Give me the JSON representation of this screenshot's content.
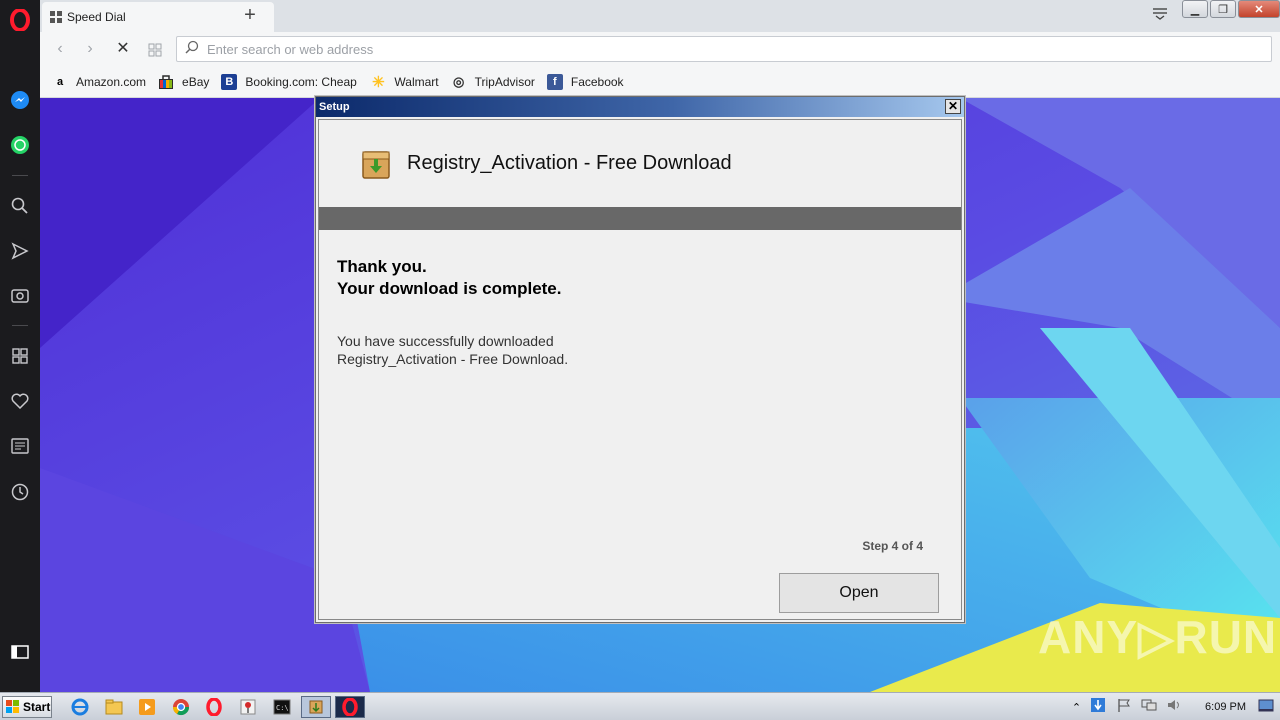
{
  "browser": {
    "tab_title": "Speed Dial",
    "new_tab_symbol": "+",
    "address_placeholder": "Enter search or web address"
  },
  "bookmarks": [
    {
      "label": "Amazon.com",
      "icon": "amazon-icon",
      "glyph": "a"
    },
    {
      "label": "eBay",
      "icon": "ebay-icon",
      "glyph": ""
    },
    {
      "label": "Booking.com: Cheap Ho",
      "icon": "booking-icon",
      "glyph": "B"
    },
    {
      "label": "Walmart",
      "icon": "walmart-icon",
      "glyph": "✳"
    },
    {
      "label": "TripAdvisor",
      "icon": "tripadvisor-icon",
      "glyph": "◎"
    },
    {
      "label": "Facebook",
      "icon": "facebook-icon",
      "glyph": "f"
    }
  ],
  "dialog": {
    "title": "Setup",
    "heading": "Registry_Activation - Free Download",
    "thanks_line1": "Thank you.",
    "thanks_line2": "Your download is complete.",
    "message_line1": "You have successfully downloaded",
    "message_line2": "Registry_Activation - Free Download.",
    "step": "Step 4 of 4",
    "open_button": "Open"
  },
  "taskbar": {
    "start_label": "Start",
    "clock": "6:09 PM"
  },
  "watermark": "ANY▷RUN",
  "colors": {
    "opera_red": "#ff1b2d",
    "dialog_band": "#686868",
    "titlebar_start": "#0c2a6b"
  }
}
